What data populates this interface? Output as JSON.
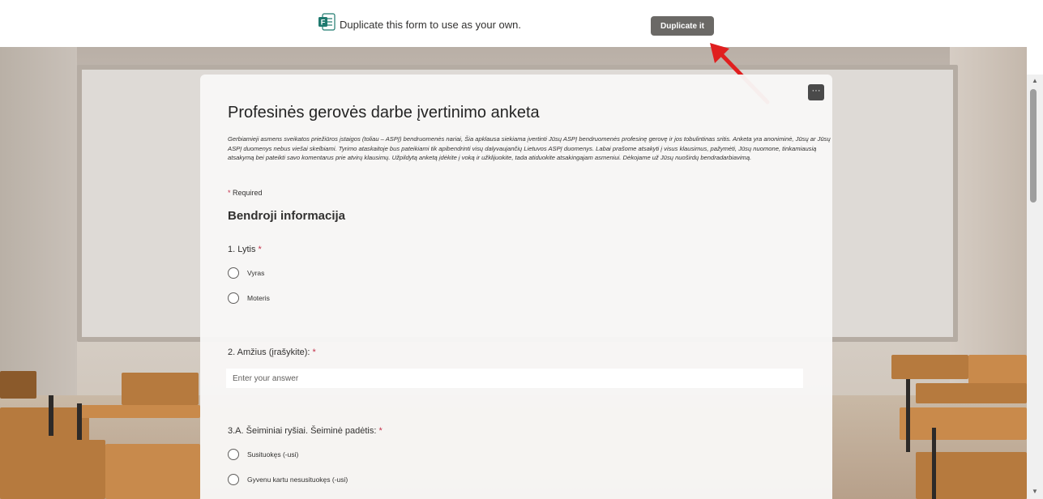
{
  "banner": {
    "text": "Duplicate this form to use as your own.",
    "duplicate_label": "Duplicate it",
    "logo_icon": "microsoft-forms-icon"
  },
  "colors": {
    "accent_arrow": "#e01f1f",
    "button_bg": "#6b6966",
    "required_star": "#c4314b",
    "forms_green": "#1f7a6f"
  },
  "form": {
    "title": "Profesinės gerovės darbe įvertinimo anketa",
    "description": "Gerbiamieji asmens sveikatos priežiūros įstaigos (toliau – ASPĮ) bendruomenės nariai, Šia apklausa siekiama įvertinti Jūsų ASPĮ bendruomenės profesinę gerovę ir jos tobulintinas sritis. Anketa yra anoniminė, Jūsų ar Jūsų ASPĮ duomenys nebus viešai skelbiami. Tyrimo ataskaitoje bus pateikiami tik apibendrinti visų dalyvaujančių Lietuvos ASPĮ duomenys. Labai prašome atsakyti į visus klausimus, pažymėti, Jūsų nuomone, tinkamiausią atsakymą bei pateikti savo komentarus prie atvirų klausimų. Užpildytą anketą įdėkite į voką ir užklijuokite, tada atiduokite atsakingajam asmeniui. Dėkojame už Jūsų nuoširdų bendradarbiavimą.",
    "required_note": "Required",
    "required_star": "*",
    "more_label": "···",
    "section_title": "Bendroji informacija",
    "questions": [
      {
        "label": "1. Lytis",
        "options": [
          "Vyras",
          "Moteris"
        ]
      },
      {
        "label": "2. Amžius (įrašykite):",
        "placeholder": "Enter your answer"
      },
      {
        "label": "3.A. Šeiminiai ryšiai. Šeiminė padėtis:",
        "options": [
          "Susituokęs (-usi)",
          "Gyvenu kartu nesusituokęs (-usi)"
        ]
      }
    ]
  },
  "scrollbar": {
    "up": "▲",
    "down": "▼"
  }
}
